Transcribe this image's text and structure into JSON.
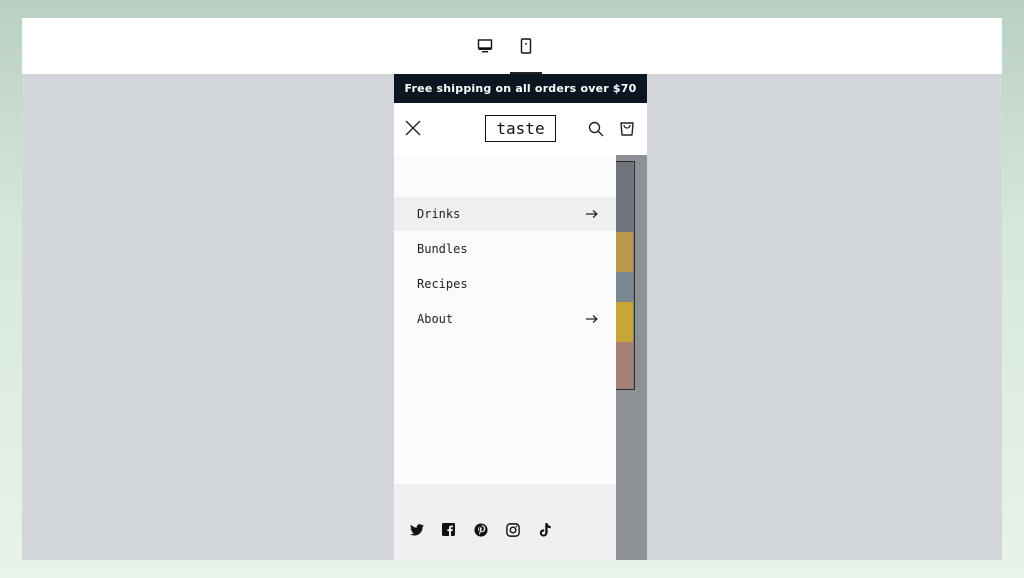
{
  "preview": {
    "devices": [
      {
        "name": "desktop",
        "icon": "desktop-icon",
        "selected": false
      },
      {
        "name": "mobile",
        "icon": "mobile-icon",
        "selected": true
      }
    ]
  },
  "store": {
    "announcement": "Free shipping on all orders over $70",
    "logo": "taste",
    "menu": [
      {
        "label": "Drinks",
        "has_submenu": true,
        "active": true
      },
      {
        "label": "Bundles",
        "has_submenu": false,
        "active": false
      },
      {
        "label": "Recipes",
        "has_submenu": false,
        "active": false
      },
      {
        "label": "About",
        "has_submenu": true,
        "active": false
      }
    ],
    "social": [
      "twitter-icon",
      "facebook-icon",
      "pinterest-icon",
      "instagram-icon",
      "tiktok-icon"
    ]
  },
  "colors": {
    "announcement_bg": "#0b1622",
    "preview_bg": "#d3d6db",
    "drawer_bg": "#fbfbfb"
  }
}
